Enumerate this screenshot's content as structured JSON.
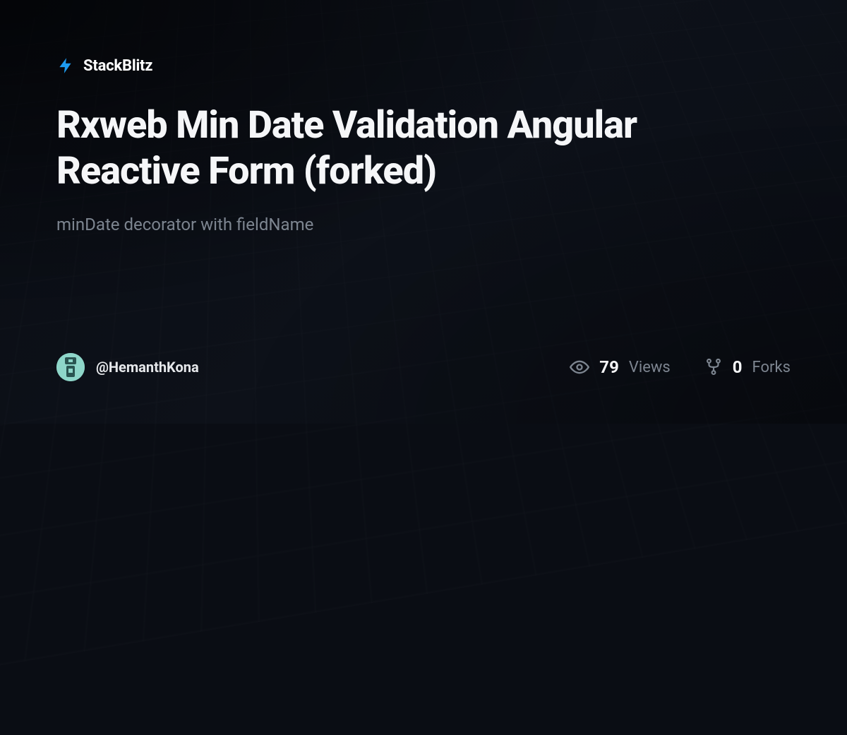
{
  "brand": {
    "name": "StackBlitz"
  },
  "project": {
    "title": "Rxweb Min Date Validation Angular Reactive Form (forked)",
    "description": "minDate decorator with fieldName"
  },
  "author": {
    "handle": "@HemanthKona"
  },
  "stats": {
    "views": {
      "value": "79",
      "label": "Views"
    },
    "forks": {
      "value": "0",
      "label": "Forks"
    }
  },
  "colors": {
    "accent": "#1e9cf0",
    "background": "#0a0d14",
    "text_primary": "#f5f6f8",
    "text_muted": "#7d8590"
  }
}
